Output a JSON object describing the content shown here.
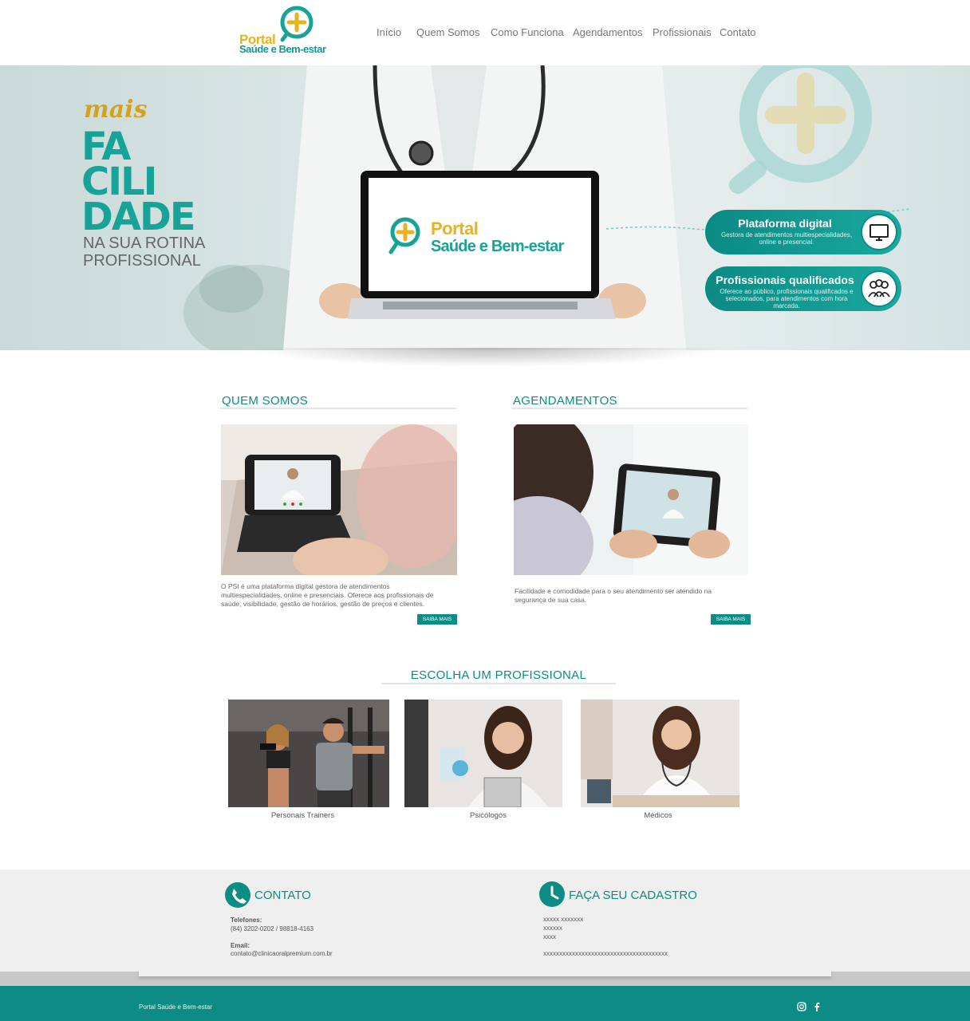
{
  "brand": {
    "line1": "Portal",
    "line2": "Saúde e Bem-estar",
    "color_primary": "#0c8c85",
    "color_accent": "#e7b320"
  },
  "nav": {
    "items": [
      "Início",
      "Quem Somos",
      "Como Funciona",
      "Agendamentos",
      "Profissionais",
      "Contato"
    ]
  },
  "hero": {
    "script_word": "mais",
    "big_lines": [
      "FA",
      "CILI",
      "DADE"
    ],
    "sub_lines": [
      "NA SUA ROTINA",
      "PROFISSIONAL"
    ],
    "laptop_line1": "Portal",
    "laptop_line2": "Saúde e Bem-estar",
    "cards": [
      {
        "title": "Plataforma digital",
        "desc": "Gestora de atendimentos multiespecialidades, online e presencial.",
        "icon": "monitor-icon"
      },
      {
        "title": "Profissionais qualificados",
        "desc": "Oferece ao público, profissionais qualificados e selecionados, para atendimentos com hora marcada.",
        "icon": "group-icon"
      }
    ]
  },
  "quem_somos": {
    "title": "QUEM SOMOS",
    "text": "O PSI é uma plataforma digital gestora de atendimentos multiespecialidades, online e presenciais. Oferece aos profissionais de saúde, visibilidade, gestão de horários, gestão de preços e clientes.",
    "button": "SAIBA MAIS"
  },
  "agendamentos": {
    "title": "AGENDAMENTOS",
    "text": "Facilidade e comodidade para o seu atendimento ser atendido na segurança de sua casa.",
    "button": "SAIBA MAIS"
  },
  "profissionais": {
    "title": "ESCOLHA UM PROFISSIONAL",
    "items": [
      "Personais Trainers",
      "Psicólogos",
      "Médicos"
    ]
  },
  "contato": {
    "title": "CONTATO",
    "phone_label": "Telefones:",
    "phone_value": "(84) 3202-0202 / 98818-4163",
    "email_label": "Email:",
    "email_value": "contato@clinicaoralpremium.com.br"
  },
  "cadastro": {
    "title": "FAÇA SEU CADASTRO",
    "lines": [
      "xxxxx xxxxxxx",
      "xxxxxx",
      "xxxx",
      "xxxxxxxxxxxxxxxxxxxxxxxxxxxxxxxxxxxxxxx"
    ]
  },
  "footer": {
    "text": "Portal Saúde e Bem-estar",
    "social": [
      "instagram-icon",
      "facebook-icon"
    ]
  }
}
